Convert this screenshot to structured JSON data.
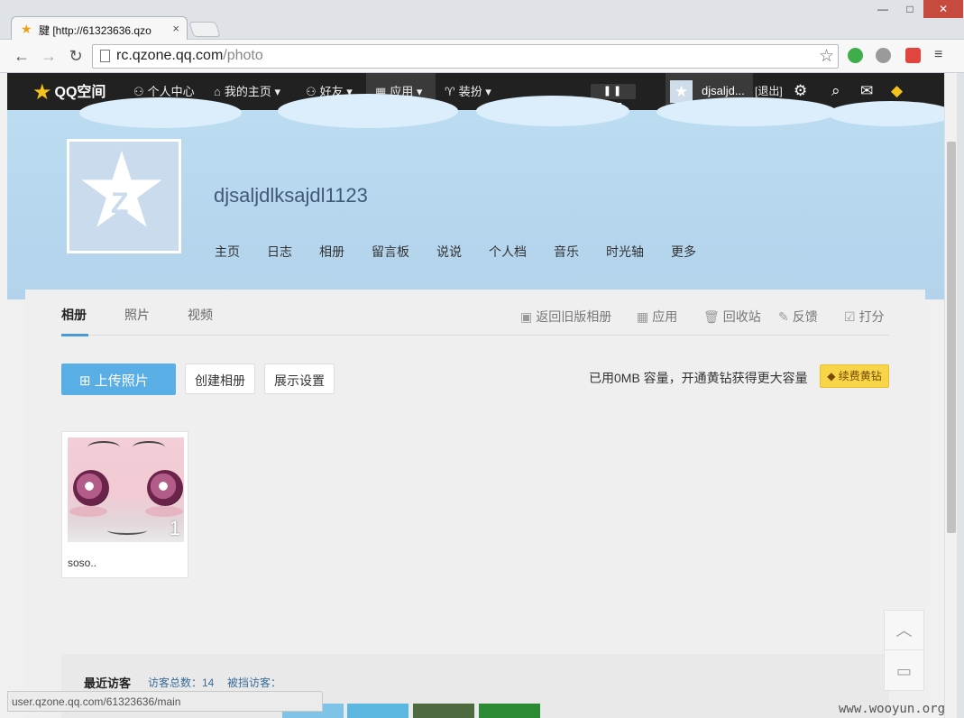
{
  "browser": {
    "tab_title": "腱 [http://61323636.qzo",
    "tab_close": "×",
    "window_min": "—",
    "window_max": "□",
    "window_close": "✕",
    "url_host": "rc.qzone.qq.com",
    "url_path": "/photo",
    "status_url": "user.qzone.qq.com/61323636/main"
  },
  "topbar": {
    "logo": "QQ空间",
    "personal_center": "个人中心",
    "my_home": "我的主页",
    "friends": "好友",
    "apps": "应用",
    "dress_up": "装扮",
    "music_controls": "❚❚ ▮▮▮",
    "user_name": "djsaljd...",
    "logout": "[退出]"
  },
  "profile": {
    "owner_name": "djsaljdlksajdl1123",
    "nav": [
      "主页",
      "日志",
      "相册",
      "留言板",
      "说说",
      "个人档",
      "音乐",
      "时光轴",
      "更多"
    ]
  },
  "photo": {
    "tabs": [
      "相册",
      "照片",
      "视频"
    ],
    "tools": {
      "old_version": "返回旧版相册",
      "apps": "应用",
      "recycle": "回收站",
      "feedback": "反馈",
      "rate": "打分"
    },
    "upload_label": "上传照片",
    "create_album": "创建相册",
    "display_settings": "展示设置",
    "quota_text": "已用0MB 容量，开通黄钻获得更大容量",
    "renew_label": "续费黄钻",
    "albums": [
      {
        "name": "soso..",
        "count": "1"
      }
    ]
  },
  "visitors": {
    "title": "最近访客",
    "total": "访客总数：14",
    "blocked": "被挡访客："
  },
  "watermark": "www.wooyun.org",
  "colors": {
    "accent": "#5aaee6",
    "topbar": "#212121",
    "gold": "#f8d548",
    "close": "#c74a3e"
  }
}
